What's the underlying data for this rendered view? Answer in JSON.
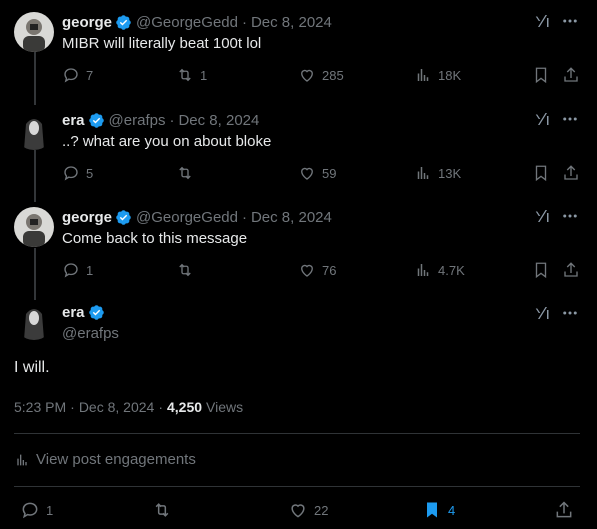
{
  "tweets": [
    {
      "name": "george",
      "handle": "@GeorgeGedd",
      "date": "Dec 8, 2024",
      "text": "MIBR will literally beat 100t lol",
      "replies": "7",
      "retweets": "1",
      "likes": "285",
      "views": "18K",
      "avatar": "george"
    },
    {
      "name": "era",
      "handle": "@erafps",
      "date": "Dec 8, 2024",
      "text": "..? what are you on about bloke",
      "replies": "5",
      "retweets": "",
      "likes": "59",
      "views": "13K",
      "avatar": "era"
    },
    {
      "name": "george",
      "handle": "@GeorgeGedd",
      "date": "Dec 8, 2024",
      "text": "Come back to this message",
      "replies": "1",
      "retweets": "",
      "likes": "76",
      "views": "4.7K",
      "avatar": "george"
    }
  ],
  "main": {
    "name": "era",
    "handle": "@erafps",
    "text": "I will.",
    "time": "5:23 PM",
    "date": "Dec 8, 2024",
    "views_count": "4,250",
    "views_label": "Views",
    "engagements_label": "View post engagements",
    "replies": "1",
    "retweets": "",
    "likes": "22",
    "bookmarks": "4"
  },
  "meta_separator": "·",
  "colors": {
    "background": "#000000",
    "text": "#e7e9ea",
    "muted": "#71767b",
    "verified": "#1d9bf0",
    "bookmark_active": "#1d9bf0",
    "divider": "#2f3336"
  }
}
